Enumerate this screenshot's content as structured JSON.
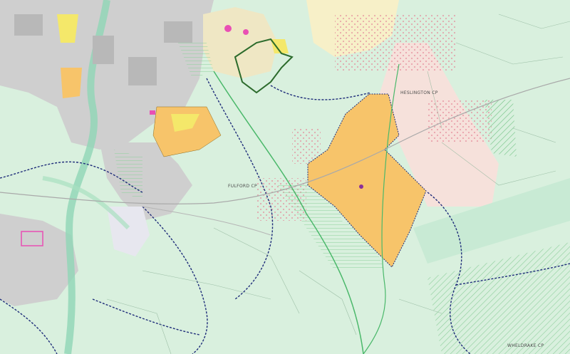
{
  "map": {
    "parish_labels": {
      "fulford": "FULFORD CP",
      "heslington": "HESLINGTON CP",
      "wheldrake": "WHELDRAKE CP"
    },
    "colors": {
      "greenbelt": "#d9f0de",
      "urban": "#cfcfcf",
      "allocation": "#f7c46a",
      "residential_yellow": "#f4e86a",
      "pink_zone": "#f6e1db",
      "conservation": "#efe7c4",
      "boundary_blue": "#1f2d7a",
      "boundary_green": "#2c6b2c",
      "magenta": "#e94fb4",
      "river": "#8ed6b5"
    }
  }
}
